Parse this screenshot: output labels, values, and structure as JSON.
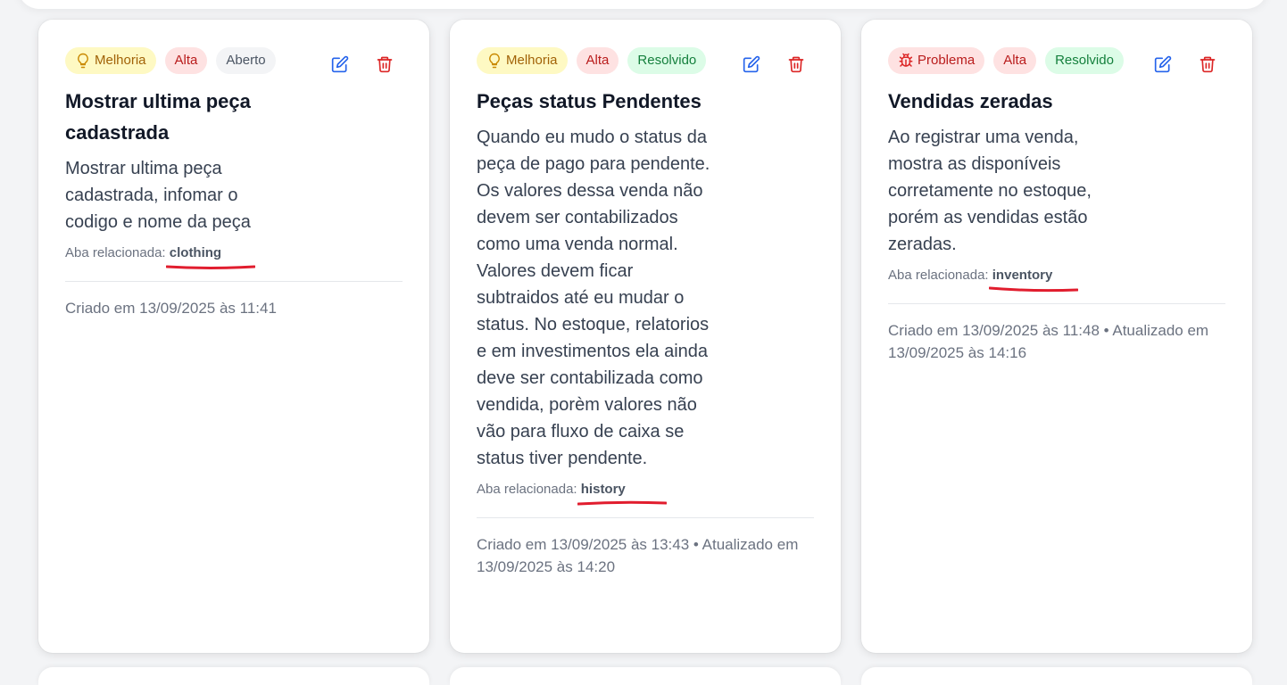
{
  "common": {
    "related_prefix": "Aba relacionada:",
    "edit_icon": "edit-icon",
    "delete_icon": "trash-icon"
  },
  "cards": [
    {
      "type_label": "Melhoria",
      "type_icon": "lightbulb-icon",
      "priority_label": "Alta",
      "status_label": "Aberto",
      "title": "Mostrar ultima peça cadastrada",
      "description": "Mostrar ultima peça cadastrada, infomar o codigo e nome da peça",
      "related_tab": "clothing",
      "meta": "Criado em 13/09/2025 às 11:41"
    },
    {
      "type_label": "Melhoria",
      "type_icon": "lightbulb-icon",
      "priority_label": "Alta",
      "status_label": "Resolvido",
      "title": "Peças status Pendentes",
      "description": "Quando eu mudo o status da peça de pago para pendente. Os valores dessa venda não devem ser contabilizados como uma venda normal. Valores devem ficar subtraidos até eu mudar o status. No estoque, relatorios e em investimentos ela ainda deve ser contabilizada como vendida, porèm valores não vão para fluxo de caixa se status tiver pendente.",
      "related_tab": "history",
      "meta": "Criado em 13/09/2025 às 13:43 • Atualizado em 13/09/2025 às 14:20"
    },
    {
      "type_label": "Problema",
      "type_icon": "bug-icon",
      "priority_label": "Alta",
      "status_label": "Resolvido",
      "title": "Vendidas zeradas",
      "description": "Ao registrar uma venda, mostra as disponíveis corretamente no estoque, porém as vendidas estão zeradas.",
      "related_tab": "inventory",
      "meta": "Criado em 13/09/2025 às 11:48 • Atualizado em 13/09/2025 às 14:16"
    }
  ],
  "colors": {
    "idea_bg": "#fef9c3",
    "idea_fg": "#a16207",
    "priority_bg": "#fee2e2",
    "priority_fg": "#b91c1c",
    "open_bg": "#f3f4f6",
    "open_fg": "#4b5563",
    "resolved_bg": "#dcfce7",
    "resolved_fg": "#15803d",
    "edit_icon": "#2563eb",
    "delete_icon": "#dc2626",
    "annotation_underline": "#e11d2e"
  }
}
